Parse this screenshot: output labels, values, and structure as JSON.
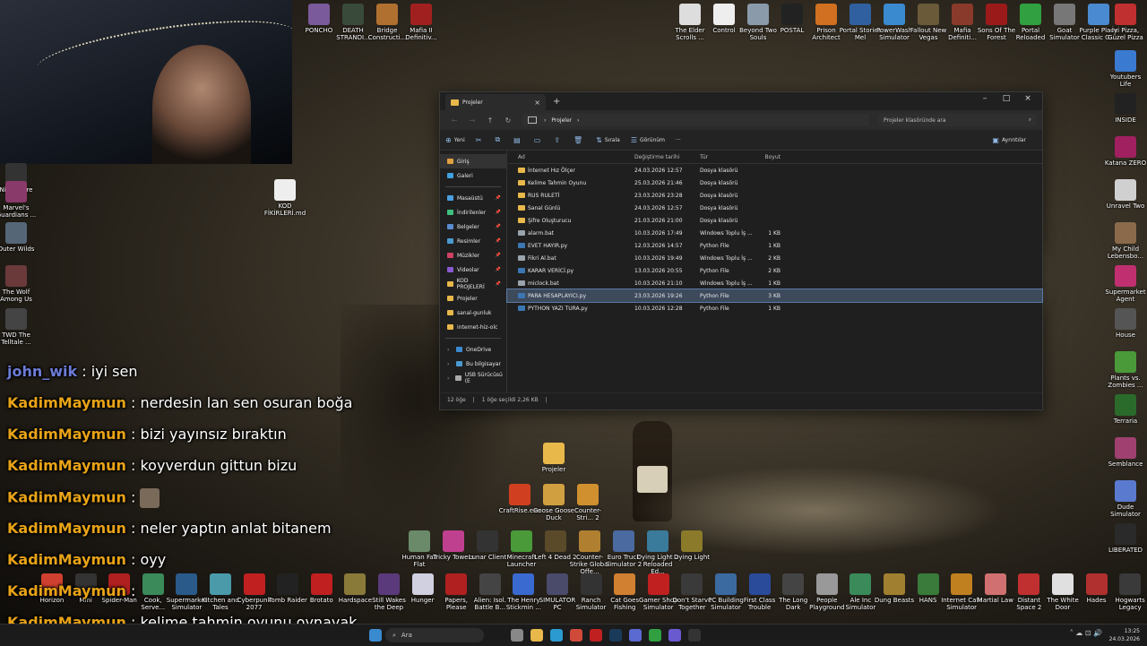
{
  "webcam": {
    "label": "streamer webcam"
  },
  "desktop_icons_top": [
    {
      "label": "PONCHO",
      "color": "#7a5a9a"
    },
    {
      "label": "DEATH STRANDI...",
      "color": "#3a4a3a"
    },
    {
      "label": "Bridge Constructi...",
      "color": "#b07030"
    },
    {
      "label": "Mafia II Definitiv...",
      "color": "#a02020"
    },
    {
      "label": "The Elder Scrolls ...",
      "color": "#dddddd"
    },
    {
      "label": "Control",
      "color": "#eeeeee"
    },
    {
      "label": "Beyond Two Souls",
      "color": "#8a9aaa"
    },
    {
      "label": "POSTAL",
      "color": "#222222"
    },
    {
      "label": "Prison Architect",
      "color": "#d07020"
    },
    {
      "label": "Portal Stories Mel",
      "color": "#3060a0"
    },
    {
      "label": "PowerWash Simulator",
      "color": "#3a8ad0"
    },
    {
      "label": "Fallout New Vegas",
      "color": "#6a5a3a"
    },
    {
      "label": "Mafia Definiti...",
      "color": "#8a3a2a"
    },
    {
      "label": "Sons Of The Forest",
      "color": "#9a1a1a"
    },
    {
      "label": "Portal Reloaded",
      "color": "#30a040"
    },
    {
      "label": "Goat Simulator",
      "color": "#777777"
    },
    {
      "label": "Purple Place Classic G...",
      "color": "#4a8ad0"
    },
    {
      "label": "İyi Pizza, Güzel Pizza",
      "color": "#c03030"
    }
  ],
  "desktop_icons_right": [
    {
      "label": "Youtubers Life",
      "color": "#3a7ad0"
    },
    {
      "label": "INSIDE",
      "color": "#222222"
    },
    {
      "label": "Katana ZERO",
      "color": "#a02060"
    },
    {
      "label": "Unravel Two",
      "color": "#d0d0d0"
    },
    {
      "label": "My Child Lebensbo...",
      "color": "#8a6a4a"
    },
    {
      "label": "Supermarket Agent",
      "color": "#c03070"
    },
    {
      "label": "House",
      "color": "#555555"
    },
    {
      "label": "Plants vs. Zombies ...",
      "color": "#4a9a3a"
    },
    {
      "label": "Terraria",
      "color": "#2a6a2a"
    },
    {
      "label": "Semblance",
      "color": "#a04070"
    },
    {
      "label": "Dude Simulator",
      "color": "#5a7ad0"
    },
    {
      "label": "LIBERATED",
      "color": "#2a2a2a"
    }
  ],
  "desktop_icons_left": [
    {
      "label": "Nightmare",
      "color": "#333333"
    },
    {
      "label": "Marvel's Guardians ...",
      "color": "#8a3a6a"
    },
    {
      "label": "Outer Wilds",
      "color": "#556677"
    },
    {
      "label": "The Wolf Among Us",
      "color": "#6a3a3a"
    },
    {
      "label": "TWD The Telltale ...",
      "color": "#444444"
    }
  ],
  "desktop_icons_mid": [
    {
      "label": "KOD FİKİRLERİ.md",
      "color": "#eeeeee"
    },
    {
      "label": "Projeler",
      "color": "#e8b84a"
    },
    {
      "label": "CraftRise.exe",
      "color": "#d04020"
    },
    {
      "label": "Goose Goose Duck",
      "color": "#d0a040"
    },
    {
      "label": "Counter-Stri... 2",
      "color": "#d09030"
    }
  ],
  "desktop_icons_row1": [
    {
      "label": "Human Fall Flat",
      "color": "#6a8a6a"
    },
    {
      "label": "Tricky Towers",
      "color": "#c04090"
    },
    {
      "label": "Lunar Client",
      "color": "#333333"
    },
    {
      "label": "Minecraft Launcher",
      "color": "#4a9a3a"
    },
    {
      "label": "Left 4 Dead 2",
      "color": "#5a4a2a"
    },
    {
      "label": "Counter-Strike Global Offe...",
      "color": "#b08030"
    },
    {
      "label": "Euro Truck Simulator 2",
      "color": "#4a6aa0"
    },
    {
      "label": "Dying Light 2 Reloaded Ed...",
      "color": "#3a7a9a"
    },
    {
      "label": "Dying Light",
      "color": "#8a7a2a"
    }
  ],
  "desktop_icons_row2": [
    {
      "label": "Horizon",
      "color": "#d04030"
    },
    {
      "label": "Mini",
      "color": "#333333"
    },
    {
      "label": "Spider-Man",
      "color": "#b02020"
    },
    {
      "label": "Cook, Serve...",
      "color": "#3a8a5a"
    },
    {
      "label": "Supermarket Simulator",
      "color": "#2a5a8a"
    },
    {
      "label": "Kitchen and Tales",
      "color": "#4a9aaa"
    },
    {
      "label": "Cyberpunk 2077",
      "color": "#c02020"
    },
    {
      "label": "Tomb Raider",
      "color": "#222222"
    },
    {
      "label": "Brotato",
      "color": "#c02020"
    },
    {
      "label": "Hardspace",
      "color": "#8a7a3a"
    },
    {
      "label": "Still Wakes the Deep",
      "color": "#5a3a7a"
    },
    {
      "label": "Hunger",
      "color": "#d0d0e0"
    },
    {
      "label": "Papers, Please",
      "color": "#b02020"
    },
    {
      "label": "Alien: Isol. Battle B...",
      "color": "#444444"
    },
    {
      "label": "The Henry Stickmin ...",
      "color": "#3a6ad0"
    },
    {
      "label": "SIMULATOR PC",
      "color": "#4a4a6a"
    },
    {
      "label": "Ranch Simulator",
      "color": "#333333"
    },
    {
      "label": "Cat Goes Fishing",
      "color": "#d08030"
    },
    {
      "label": "Gamer Shop Simulator",
      "color": "#c02020"
    },
    {
      "label": "Don't Starve Together",
      "color": "#3a3a3a"
    },
    {
      "label": "PC Building Simulator",
      "color": "#3a6aa0"
    },
    {
      "label": "First Class Trouble",
      "color": "#2a4a9a"
    },
    {
      "label": "The Long Dark",
      "color": "#444444"
    },
    {
      "label": "People Playground",
      "color": "#999999"
    },
    {
      "label": "Ale Inc Simulator",
      "color": "#3a8a5a"
    },
    {
      "label": "Dung Beasts",
      "color": "#a08030"
    },
    {
      "label": "HANS",
      "color": "#3a7a3a"
    },
    {
      "label": "Internet Cafe Simulator",
      "color": "#c08020"
    },
    {
      "label": "Martial Law",
      "color": "#d07070"
    },
    {
      "label": "Distant Space 2",
      "color": "#c03030"
    },
    {
      "label": "The White Door",
      "color": "#e0e0e0"
    },
    {
      "label": "Hades",
      "color": "#b03030"
    },
    {
      "label": "Hogwarts Legacy",
      "color": "#3a3a3a"
    }
  ],
  "explorer": {
    "tab_title": "Projeler",
    "close": "×",
    "new_tab": "+",
    "min": "–",
    "max": "□",
    "close_win": "×",
    "breadcrumb": "Projeler",
    "breadcrumb_sep": "›",
    "search_placeholder": "Projeler klasöründe ara",
    "toolbar": {
      "new": "Yeni",
      "sort": "Sırala",
      "view": "Görünüm",
      "more": "···",
      "details": "Ayrıntılar"
    },
    "nav": [
      {
        "label": "Giriş",
        "color": "#e0a040",
        "selected": true,
        "pin": false
      },
      {
        "label": "Galeri",
        "color": "#40a0e0",
        "selected": false,
        "pin": false
      }
    ],
    "nav_quick": [
      {
        "label": "Masaüstü",
        "color": "#4aa0e0",
        "pin": "📌"
      },
      {
        "label": "İndirilenler",
        "color": "#40c080",
        "pin": "📌"
      },
      {
        "label": "Belgeler",
        "color": "#5a8ad0",
        "pin": "📌"
      },
      {
        "label": "Resimler",
        "color": "#4a9ad0",
        "pin": "📌"
      },
      {
        "label": "Müzikler",
        "color": "#d04060",
        "pin": "📌"
      },
      {
        "label": "Videolar",
        "color": "#8a5ad0",
        "pin": "📌"
      },
      {
        "label": "KOD PROJELERİ",
        "color": "#e8b84a",
        "pin": "📌"
      },
      {
        "label": "Projeler",
        "color": "#e8b84a",
        "pin": ""
      },
      {
        "label": "sanal-gunluk",
        "color": "#e8b84a",
        "pin": ""
      },
      {
        "label": "internet-hiz-olc",
        "color": "#e8b84a",
        "pin": ""
      }
    ],
    "nav_bottom": [
      {
        "label": "OneDrive",
        "color": "#3a8ad0"
      },
      {
        "label": "Bu bilgisayar",
        "color": "#4a9ad0"
      },
      {
        "label": "USB Sürücüsü (E",
        "color": "#aaaaaa"
      }
    ],
    "columns": {
      "name": "Ad",
      "date": "Değiştirme tarihi",
      "type": "Tür",
      "size": "Boyut"
    },
    "files": [
      {
        "name": "İnternet Hız Ölçer",
        "date": "24.03.2026 12:57",
        "type": "Dosya klasörü",
        "size": "",
        "kind": "folder",
        "selected": false
      },
      {
        "name": "Kelime Tahmin Oyunu",
        "date": "25.03.2026 21:46",
        "type": "Dosya klasörü",
        "size": "",
        "kind": "folder",
        "selected": false
      },
      {
        "name": "RUS RULETİ",
        "date": "23.03.2026 23:28",
        "type": "Dosya klasörü",
        "size": "",
        "kind": "folder",
        "selected": false
      },
      {
        "name": "Sanal Günlü",
        "date": "24.03.2026 12:57",
        "type": "Dosya klasörü",
        "size": "",
        "kind": "folder",
        "selected": false
      },
      {
        "name": "Şifre Oluşturucu",
        "date": "21.03.2026 21:00",
        "type": "Dosya klasörü",
        "size": "",
        "kind": "folder",
        "selected": false
      },
      {
        "name": "alarm.bat",
        "date": "10.03.2026 17:49",
        "type": "Windows Toplu İş ...",
        "size": "1 KB",
        "kind": "bat",
        "selected": false
      },
      {
        "name": "EVET HAYIR.py",
        "date": "12.03.2026 14:57",
        "type": "Python File",
        "size": "1 KB",
        "kind": "py",
        "selected": false
      },
      {
        "name": "Fikri Al.bat",
        "date": "10.03.2026 19:49",
        "type": "Windows Toplu İş ...",
        "size": "2 KB",
        "kind": "bat",
        "selected": false
      },
      {
        "name": "KARAR VERİCİ.py",
        "date": "13.03.2026 20:55",
        "type": "Python File",
        "size": "2 KB",
        "kind": "py",
        "selected": false
      },
      {
        "name": "miclock.bat",
        "date": "10.03.2026 21:10",
        "type": "Windows Toplu İş ...",
        "size": "1 KB",
        "kind": "bat",
        "selected": false
      },
      {
        "name": "PARA HESAPLAYICI.py",
        "date": "23.03.2026 19:26",
        "type": "Python File",
        "size": "3 KB",
        "kind": "py",
        "selected": true
      },
      {
        "name": "PYTHON YAZI TURA.py",
        "date": "10.03.2026 12:28",
        "type": "Python File",
        "size": "1 KB",
        "kind": "py",
        "selected": false
      }
    ],
    "status": {
      "count": "12 öğe",
      "sep": "|",
      "selected": "1 öğe seçildi  2,26 KB",
      "sep2": "|"
    }
  },
  "chat": [
    {
      "user": "john_wik",
      "sep": " : ",
      "msg": "iyi sen",
      "alt": true,
      "emote": false
    },
    {
      "user": "KadimMaymun",
      "sep": " : ",
      "msg": "nerdesin lan sen osuran boğa",
      "alt": false,
      "emote": false
    },
    {
      "user": "KadimMaymun",
      "sep": " : ",
      "msg": "bizi yayınsız bıraktın",
      "alt": false,
      "emote": false
    },
    {
      "user": "KadimMaymun",
      "sep": " : ",
      "msg": "koyverdun gittun bizu",
      "alt": false,
      "emote": false
    },
    {
      "user": "KadimMaymun",
      "sep": " : ",
      "msg": "",
      "alt": false,
      "emote": true
    },
    {
      "user": "KadimMaymun",
      "sep": " : ",
      "msg": "neler yaptın anlat bitanem",
      "alt": false,
      "emote": false
    },
    {
      "user": "KadimMaymun",
      "sep": " : ",
      "msg": "oyy",
      "alt": false,
      "emote": false
    },
    {
      "user": "KadimMaymun",
      "sep": " : ",
      "msg": "",
      "alt": false,
      "emote": false
    },
    {
      "user": "KadimMaymun",
      "sep": " : ",
      "msg": "kelime tahmin oyunu oynayak",
      "alt": false,
      "emote": false
    }
  ],
  "taskbar": {
    "search": "Ara",
    "clock_time": "13:25",
    "clock_date": "24.03.2026",
    "tray": "˄  ☁  ⊡  🔊",
    "apps": [
      {
        "name": "start-icon",
        "color": "#3a8ad0"
      },
      {
        "name": "task-view-icon",
        "color": "#888888"
      },
      {
        "name": "explorer-icon",
        "color": "#e8b84a"
      },
      {
        "name": "edge-icon",
        "color": "#2a9ad0"
      },
      {
        "name": "chrome-icon",
        "color": "#d04a3a"
      },
      {
        "name": "opera-icon",
        "color": "#c02020"
      },
      {
        "name": "steam-icon",
        "color": "#1a3a5a"
      },
      {
        "name": "discord-icon",
        "color": "#5a6ad0"
      },
      {
        "name": "xbox-icon",
        "color": "#30a040"
      },
      {
        "name": "teams-icon",
        "color": "#6a5ad0"
      },
      {
        "name": "obs-icon",
        "color": "#333333"
      }
    ]
  }
}
